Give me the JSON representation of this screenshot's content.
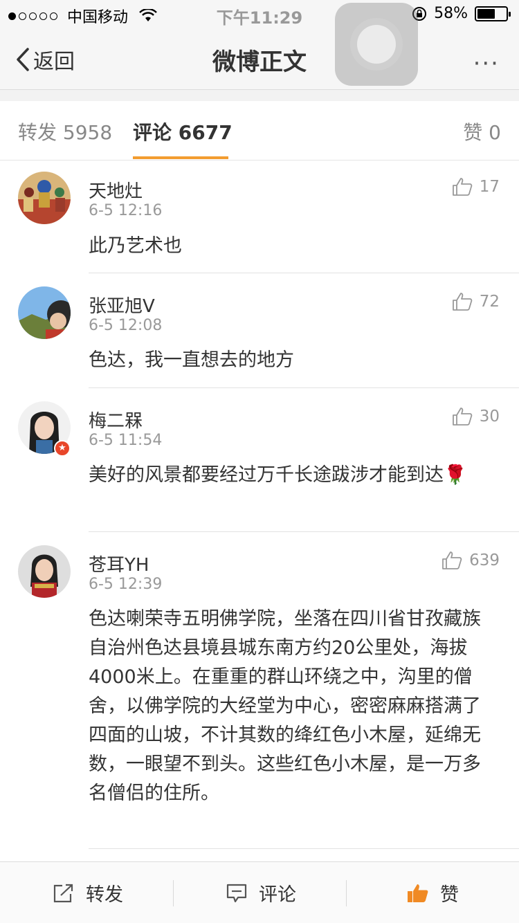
{
  "status": {
    "carrier": "中国移动",
    "time": "下午11:29",
    "battery": "58%"
  },
  "nav": {
    "back_label": "返回",
    "title": "微博正文",
    "more": "···"
  },
  "tabs": {
    "repost": "转发 5958",
    "comment": "评论 6677",
    "like": "赞 0"
  },
  "comments": [
    {
      "name": "天地灶",
      "time": "6-5 12:16",
      "likes": "17",
      "text": "此乃艺术也"
    },
    {
      "name": "张亚旭V",
      "time": "6-5 12:08",
      "likes": "72",
      "text": "色达，我一直想去的地方"
    },
    {
      "name": "梅二槑",
      "time": "6-5 11:54",
      "likes": "30",
      "text": "美好的风景都要经过万千长途跋涉才能到达🌹"
    },
    {
      "name": "苍耳YH",
      "time": "6-5 12:39",
      "likes": "639",
      "text": "色达喇荣寺五明佛学院，坐落在四川省甘孜藏族自治州色达县境县城东南方约20公里处，海拔4000米上。在重重的群山环绕之中，沟里的僧舍，以佛学院的大经堂为中心，密密麻麻搭满了四面的山坡，不计其数的绛红色小木屋，延绵无数，一眼望不到头。这些红色小木屋，是一万多名僧侣的住所。"
    }
  ],
  "bottom": {
    "repost": "转发",
    "comment": "评论",
    "like": "赞"
  },
  "colors": {
    "accent": "#f39c2f",
    "like_active": "#f08a24"
  }
}
